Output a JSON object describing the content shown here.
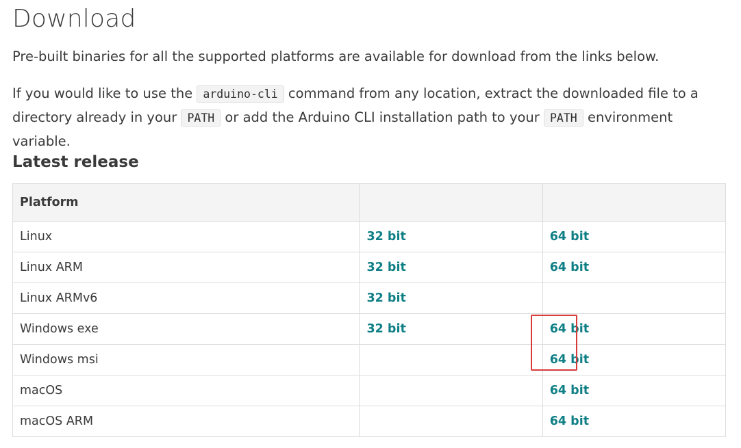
{
  "page": {
    "title": "Download",
    "intro": "Pre-built binaries for all the supported platforms are available for download from the links below.",
    "instruction": {
      "part1": "If you would like to use the ",
      "code1": "arduino-cli",
      "part2": " command from any location, extract the downloaded file to a directory already in your ",
      "code2": "PATH",
      "part3": " or add the Arduino CLI installation path to your ",
      "code3": "PATH",
      "part4": " environment variable."
    },
    "section_title": "Latest release"
  },
  "table": {
    "headers": [
      "Platform",
      "",
      ""
    ],
    "rows": [
      {
        "platform": "Linux",
        "bit32": "32 bit",
        "bit64": "64 bit"
      },
      {
        "platform": "Linux ARM",
        "bit32": "32 bit",
        "bit64": "64 bit"
      },
      {
        "platform": "Linux ARMv6",
        "bit32": "32 bit",
        "bit64": ""
      },
      {
        "platform": "Windows exe",
        "bit32": "32 bit",
        "bit64": "64 bit"
      },
      {
        "platform": "Windows msi",
        "bit32": "",
        "bit64": "64 bit"
      },
      {
        "platform": "macOS",
        "bit32": "",
        "bit64": "64 bit"
      },
      {
        "platform": "macOS ARM",
        "bit32": "",
        "bit64": "64 bit"
      }
    ]
  },
  "colors": {
    "link": "#0f7f86",
    "highlight": "#d63a3a",
    "text": "#3a3a3a",
    "header_bg": "#f4f4f4"
  }
}
